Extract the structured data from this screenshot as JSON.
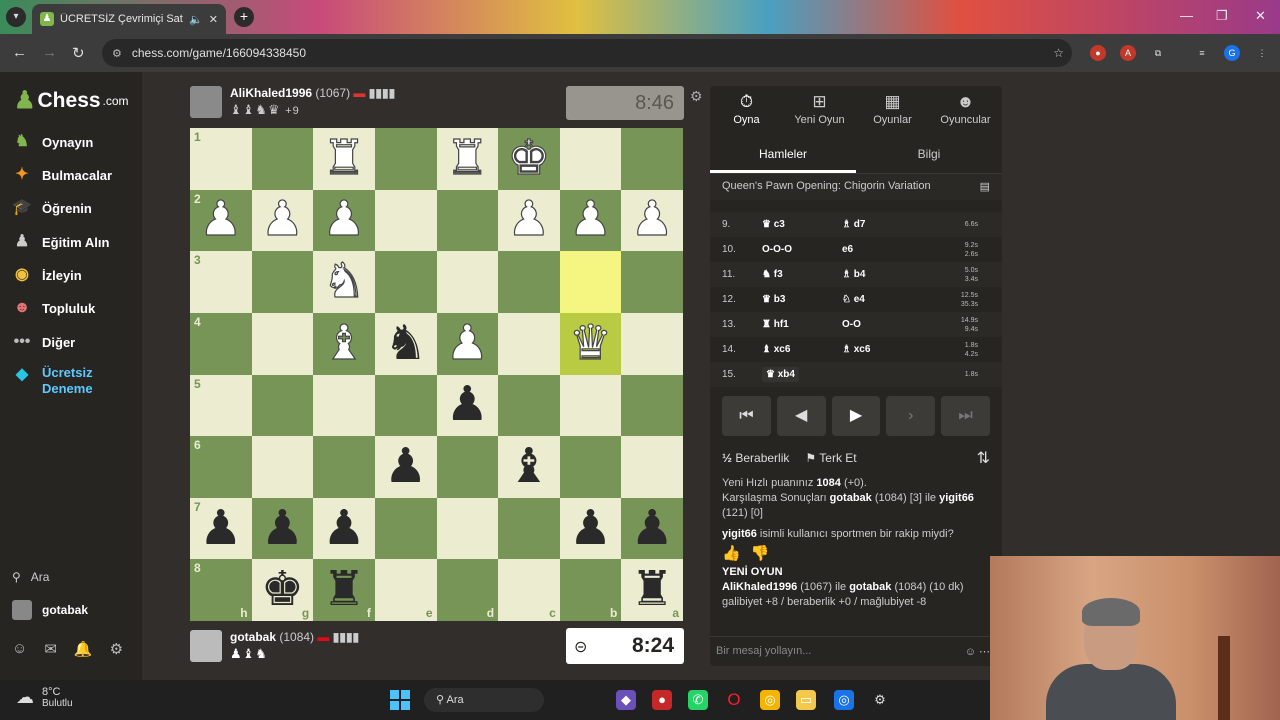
{
  "browser": {
    "tab_title": "ÜCRETSİZ Çevrimiçi Satranç",
    "url": "chess.com/game/166094338450"
  },
  "sidebar": {
    "logo": "Chess",
    "logo_suffix": ".com",
    "items": [
      {
        "label": "Oynayın",
        "icon": "play-icon"
      },
      {
        "label": "Bulmacalar",
        "icon": "puzzle-icon"
      },
      {
        "label": "Öğrenin",
        "icon": "learn-icon"
      },
      {
        "label": "Eğitim Alın",
        "icon": "train-icon"
      },
      {
        "label": "İzleyin",
        "icon": "watch-icon"
      },
      {
        "label": "Topluluk",
        "icon": "community-icon"
      },
      {
        "label": "Diğer",
        "icon": "more-icon"
      },
      {
        "label": "Ücretsiz Deneme",
        "icon": "diamond-icon"
      }
    ],
    "search_label": "Ara",
    "username": "gotabak"
  },
  "top_player": {
    "name": "AliKhaled1996",
    "rating": "(1067)",
    "captured": "♝♝♞♛",
    "material": "+9",
    "clock": "8:46"
  },
  "bottom_player": {
    "name": "gotabak",
    "rating": "(1084)",
    "captured": "♟♝♞",
    "clock": "8:24"
  },
  "board": {
    "orientation": "black",
    "rank_labels": [
      "1",
      "2",
      "3",
      "4",
      "5",
      "6",
      "7",
      "8"
    ],
    "file_labels": [
      "h",
      "g",
      "f",
      "e",
      "d",
      "c",
      "b",
      "a"
    ],
    "highlight": [
      "b3",
      "b4"
    ],
    "pieces": {
      "f1": "wR",
      "d1": "wR",
      "c1": "wK",
      "h2": "wP",
      "g2": "wP",
      "f2": "wP",
      "c2": "wP",
      "b2": "wP",
      "a2": "wP",
      "f3": "wN",
      "f4": "wB",
      "e4": "bN",
      "d4": "wP",
      "b4": "wQ",
      "d5": "bP",
      "e6": "bP",
      "c6": "bB",
      "h7": "bP",
      "g7": "bP",
      "f7": "bP",
      "b7": "bP",
      "a7": "bP",
      "g8": "bK",
      "f8": "bR",
      "a8": "bR"
    }
  },
  "panel": {
    "tabs": [
      {
        "label": "Oyna",
        "icon": "stopwatch-icon"
      },
      {
        "label": "Yeni Oyun",
        "icon": "plus-icon"
      },
      {
        "label": "Oyunlar",
        "icon": "board-icon"
      },
      {
        "label": "Oyuncular",
        "icon": "players-icon"
      }
    ],
    "subtabs": [
      "Hamleler",
      "Bilgi"
    ],
    "opening": "Queen's Pawn Opening: Chigorin Variation",
    "moves": [
      {
        "no": "9.",
        "white": "♛ c3",
        "black": "♗ d7",
        "tw": "6.6s",
        "tb": ""
      },
      {
        "no": "10.",
        "white": "O-O-O",
        "black": "e6",
        "tw": "9.2s",
        "tb": "2.6s"
      },
      {
        "no": "11.",
        "white": "♞ f3",
        "black": "♗ b4",
        "tw": "5.0s",
        "tb": "3.4s"
      },
      {
        "no": "12.",
        "white": "♛ b3",
        "black": "♘ e4",
        "tw": "12.5s",
        "tb": "35.3s"
      },
      {
        "no": "13.",
        "white": "♜ hf1",
        "black": "O-O",
        "tw": "14.9s",
        "tb": "9.4s"
      },
      {
        "no": "14.",
        "white": "♝ xc6",
        "black": "♗ xc6",
        "tw": "1.8s",
        "tb": "4.2s"
      },
      {
        "no": "15.",
        "white": "♛ xb4",
        "black": "",
        "tw": "1.8s",
        "tb": ""
      }
    ],
    "draw_label": "Beraberlik",
    "resign_label": "Terk Et",
    "chat": {
      "line1": "Yeni Hızlı puanınız",
      "line1_val": "1084",
      "line1_tail": "(+0).",
      "line2": "Karşılaşma Sonuçları",
      "line2_a": "gotabak",
      "line2_mid": "(1084) [3] ile",
      "line2_b": "yigit66",
      "line2_tail": "(121) [0]",
      "line3_user": "yigit66",
      "line3_text": "isimli kullanıcı sportmen bir rakip miydi?",
      "new_game": "YENİ OYUN",
      "ng_a": "AliKhaled1996",
      "ng_mid": "(1067) ile",
      "ng_b": "gotabak",
      "ng_tail": "(1084) (10 dk)",
      "ng_stats": "galibiyet +8 / beraberlik +0 / mağlubiyet -8"
    },
    "message_placeholder": "Bir mesaj yollayın..."
  },
  "taskbar": {
    "temp": "8°C",
    "weather": "Bulutlu",
    "search": "Ara"
  }
}
